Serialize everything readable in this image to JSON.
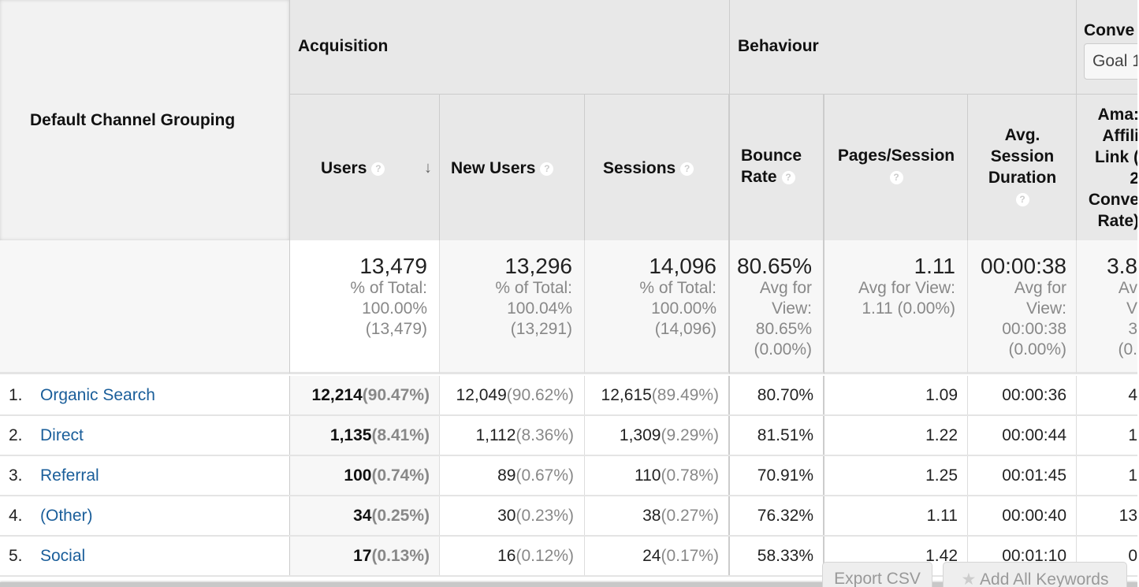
{
  "table": {
    "dimension_header": "Default Channel Grouping",
    "groups": {
      "acquisition": "Acquisition",
      "behaviour": "Behaviour",
      "conversions": "Conve",
      "goal_select": "Goal 1"
    },
    "columns": {
      "users": "Users",
      "new_users": "New Users",
      "sessions": "Sessions",
      "bounce_rate": [
        "Bounce",
        "Rate"
      ],
      "pages_session": "Pages/Session",
      "avg_session_duration": [
        "Avg.",
        "Session",
        "Duration"
      ],
      "conversion": [
        "Ama:",
        "Affili",
        "Link (",
        "2",
        "Conve",
        "Rate)"
      ]
    },
    "sort_indicator": "↓",
    "help_icon": "?",
    "totals": {
      "users": {
        "value": "13,479",
        "lines": [
          "% of Total:",
          "100.00%",
          "(13,479)"
        ]
      },
      "new_users": {
        "value": "13,296",
        "lines": [
          "% of Total:",
          "100.04%",
          "(13,291)"
        ]
      },
      "sessions": {
        "value": "14,096",
        "lines": [
          "% of Total:",
          "100.00%",
          "(14,096)"
        ]
      },
      "bounce_rate": {
        "value": "80.65%",
        "lines": [
          "Avg for",
          "View:",
          "80.65%",
          "(0.00%)"
        ]
      },
      "pages_session": {
        "value": "1.11",
        "lines": [
          "Avg for View:",
          "1.11 (0.00%)"
        ]
      },
      "avg_session_duration": {
        "value": "00:00:38",
        "lines": [
          "Avg for",
          "View:",
          "00:00:38",
          "(0.00%)"
        ]
      },
      "conversion": {
        "value": "3.8",
        "lines": [
          "Av",
          "V",
          "3",
          "(0."
        ]
      }
    },
    "rows": [
      {
        "index": "1.",
        "channel": "Organic Search",
        "users": "12,214",
        "users_pct": "(90.47%)",
        "new_users": "12,049",
        "new_users_pct": "(90.62%)",
        "sessions": "12,615",
        "sessions_pct": "(89.49%)",
        "bounce_rate": "80.70%",
        "pages_session": "1.09",
        "avg_session_duration": "00:00:36",
        "conversion": "4"
      },
      {
        "index": "2.",
        "channel": "Direct",
        "users": "1,135",
        "users_pct": "(8.41%)",
        "new_users": "1,112",
        "new_users_pct": "(8.36%)",
        "sessions": "1,309",
        "sessions_pct": "(9.29%)",
        "bounce_rate": "81.51%",
        "pages_session": "1.22",
        "avg_session_duration": "00:00:44",
        "conversion": "1"
      },
      {
        "index": "3.",
        "channel": "Referral",
        "users": "100",
        "users_pct": "(0.74%)",
        "new_users": "89",
        "new_users_pct": "(0.67%)",
        "sessions": "110",
        "sessions_pct": "(0.78%)",
        "bounce_rate": "70.91%",
        "pages_session": "1.25",
        "avg_session_duration": "00:01:45",
        "conversion": "1"
      },
      {
        "index": "4.",
        "channel": "(Other)",
        "users": "34",
        "users_pct": "(0.25%)",
        "new_users": "30",
        "new_users_pct": "(0.23%)",
        "sessions": "38",
        "sessions_pct": "(0.27%)",
        "bounce_rate": "76.32%",
        "pages_session": "1.11",
        "avg_session_duration": "00:00:40",
        "conversion": "13"
      },
      {
        "index": "5.",
        "channel": "Social",
        "users": "17",
        "users_pct": "(0.13%)",
        "new_users": "16",
        "new_users_pct": "(0.12%)",
        "sessions": "24",
        "sessions_pct": "(0.17%)",
        "bounce_rate": "58.33%",
        "pages_session": "1.42",
        "avg_session_duration": "00:01:10",
        "conversion": "0"
      }
    ]
  },
  "buttons": {
    "export_csv": "Export CSV",
    "add_all_keywords": "Add All Keywords",
    "star_icon": "★"
  }
}
